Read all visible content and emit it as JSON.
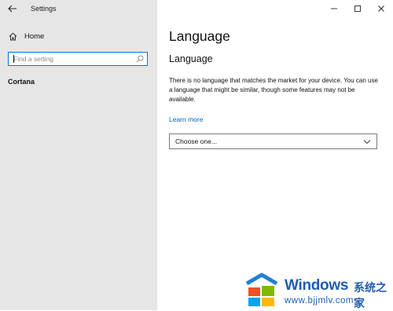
{
  "window": {
    "title": "Settings",
    "controls": [
      "minimize-icon",
      "maximize-icon",
      "close-icon"
    ]
  },
  "sidebar": {
    "home_label": "Home",
    "search_placeholder": "Find a setting",
    "section_label": "Cortana"
  },
  "main": {
    "page_title": "Language",
    "subtitle": "Language",
    "description": "There is no language that matches the market for your device. You can use a language that might be similar, though some features may not be available.",
    "learn_more": "Learn more",
    "dropdown_value": "Choose one..."
  },
  "watermark": {
    "brand": "Windows",
    "cn_text": "系统之家",
    "url": "www.bjjmlv.com"
  },
  "colors": {
    "accent": "#0078d7",
    "link": "#0067b8",
    "sidebar_bg": "#e6e6e6"
  }
}
